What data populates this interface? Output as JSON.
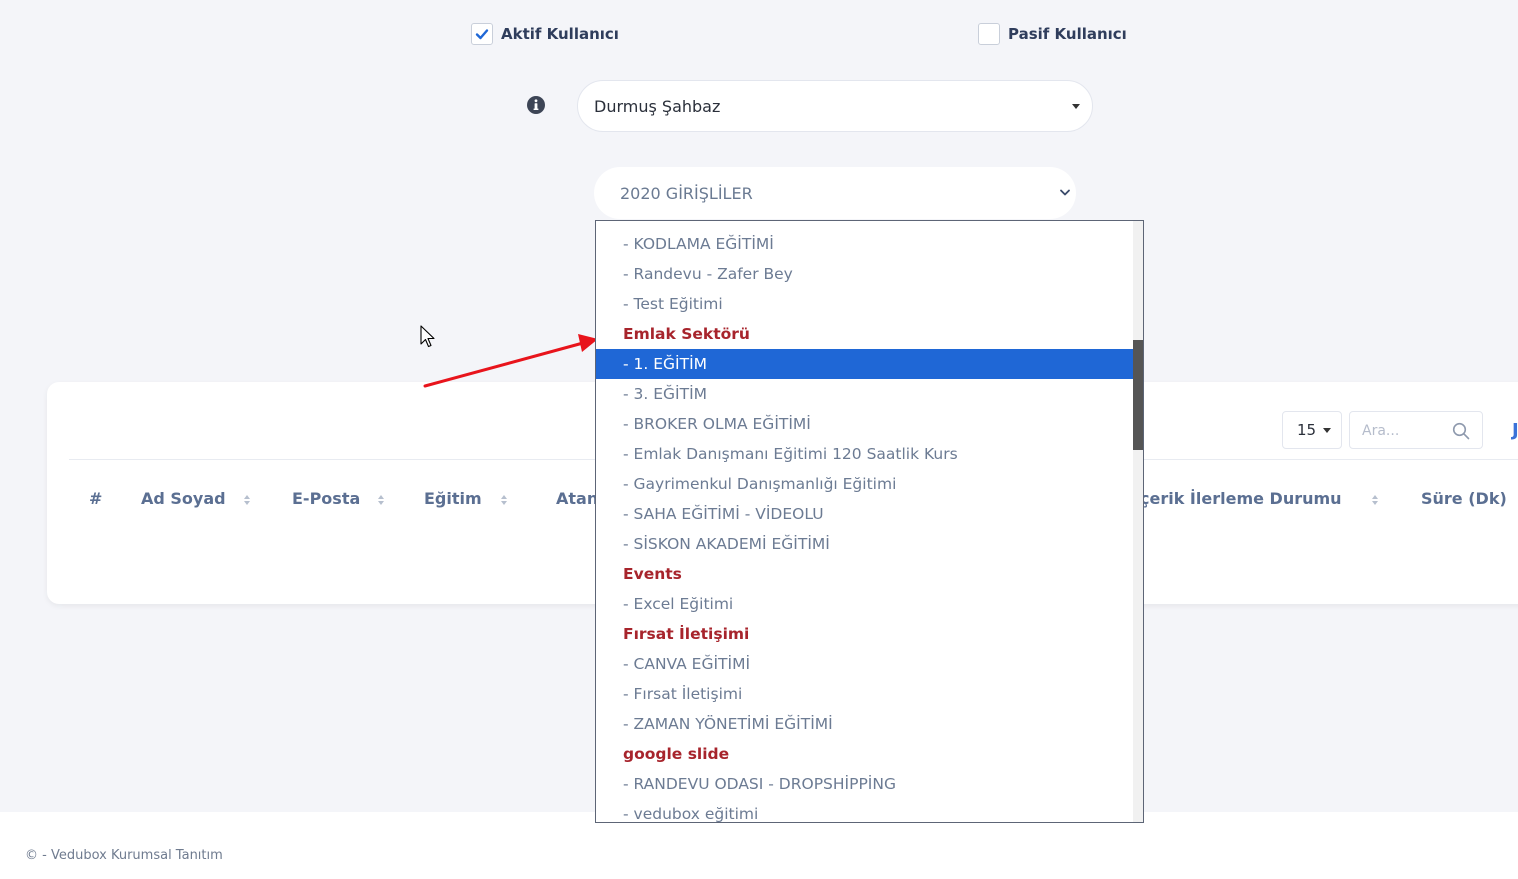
{
  "filters": {
    "active_label": "Aktif Kullanıcı",
    "active_checked": true,
    "passive_label": "Pasif Kullanıcı",
    "passive_checked": false
  },
  "user_select": {
    "value": "Durmuş Şahbaz"
  },
  "group_select": {
    "value": "2020 GİRİŞLİLER"
  },
  "dropdown": {
    "options": [
      {
        "label": "- KODLAMA EĞİTİMİ",
        "type": "item"
      },
      {
        "label": "- Randevu - Zafer Bey",
        "type": "item"
      },
      {
        "label": "- Test Eğitimi",
        "type": "item"
      },
      {
        "label": "Emlak Sektörü",
        "type": "group"
      },
      {
        "label": "- 1. EĞİTİM",
        "type": "item",
        "selected": true
      },
      {
        "label": "- 3. EĞİTİM",
        "type": "item"
      },
      {
        "label": "- BROKER OLMA EĞİTİMİ",
        "type": "item"
      },
      {
        "label": "- Emlak Danışmanı Eğitimi 120 Saatlik Kurs",
        "type": "item"
      },
      {
        "label": "- Gayrimenkul Danışmanlığı Eğitimi",
        "type": "item"
      },
      {
        "label": "- SAHA EĞİTİMİ - VİDEOLU",
        "type": "item"
      },
      {
        "label": "- SİSKON AKADEMİ EĞİTİMİ",
        "type": "item"
      },
      {
        "label": "Events",
        "type": "group"
      },
      {
        "label": "- Excel Eğitimi",
        "type": "item"
      },
      {
        "label": "Fırsat İletişimi",
        "type": "group"
      },
      {
        "label": "- CANVA EĞİTİMİ",
        "type": "item"
      },
      {
        "label": "- Fırsat İletişimi",
        "type": "item"
      },
      {
        "label": "- ZAMAN YÖNETİMİ EĞİTİMİ",
        "type": "item"
      },
      {
        "label": "google slide",
        "type": "group"
      },
      {
        "label": "- RANDEVU ODASI - DROPSHİPPİNG",
        "type": "item"
      },
      {
        "label": "- vedubox eğitimi",
        "type": "item"
      }
    ]
  },
  "table": {
    "page_size": "15",
    "search_placeholder": "Ara...",
    "edge_glyph": "J",
    "columns": {
      "hash": "#",
      "name": "Ad Soyad",
      "email": "E-Posta",
      "training": "Eğitim",
      "assigned": "Atan",
      "progress": "çerik İlerleme Durumu",
      "duration": "Süre (Dk)"
    }
  },
  "footer": {
    "text": "© - Vedubox Kurumsal Tanıtım"
  },
  "colors": {
    "accent": "#1f67d6",
    "group_label": "#a7242c",
    "annotation_arrow": "#e8141c"
  },
  "icons": {
    "info": "info-circle-icon",
    "check": "check-icon",
    "chevron": "chevron-down-icon",
    "search": "search-icon",
    "sort": "sort-icon",
    "cursor": "mouse-cursor-icon"
  }
}
